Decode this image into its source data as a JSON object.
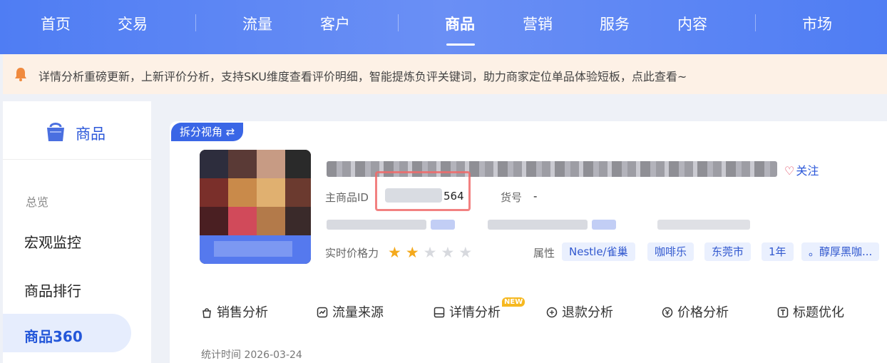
{
  "nav": {
    "items": [
      {
        "label": "首页"
      },
      {
        "label": "交易"
      },
      {
        "label": "流量"
      },
      {
        "label": "客户"
      },
      {
        "label": "商品",
        "active": true
      },
      {
        "label": "营销"
      },
      {
        "label": "服务"
      },
      {
        "label": "内容"
      },
      {
        "label": "市场"
      }
    ]
  },
  "notice": {
    "text": "详情分析重磅更新，上新评价分析，支持SKU维度查看评价明细，智能提炼负评关键词，助力商家定位单品体验短板，点此查看~"
  },
  "sidebar": {
    "title": "商品",
    "group_label": "总览",
    "items": [
      {
        "label": "宏观监控"
      },
      {
        "label": "商品排行"
      },
      {
        "label": "商品360",
        "active": true
      }
    ]
  },
  "product": {
    "split_view_label": "拆分视角 ⇄",
    "follow_label": "关注",
    "main_id_label": "主商品ID",
    "main_id_visible_suffix": "564",
    "item_no_label": "货号",
    "item_no_value": "-",
    "price_power_label": "实时价格力",
    "price_power_stars": 2,
    "price_power_max": 5,
    "attr_label": "属性",
    "attrs": [
      "Nestle/雀巢",
      "咖啡乐",
      "东莞市",
      "1年",
      "。醇厚黑咖..."
    ]
  },
  "tabs": [
    {
      "label": "销售分析",
      "icon": "bag-icon"
    },
    {
      "label": "流量来源",
      "icon": "trend-icon"
    },
    {
      "label": "详情分析",
      "icon": "detail-icon",
      "badge": "NEW"
    },
    {
      "label": "退款分析",
      "icon": "refund-icon"
    },
    {
      "label": "价格分析",
      "icon": "yen-icon"
    },
    {
      "label": "标题优化",
      "icon": "title-icon"
    }
  ],
  "stat_time": "统计时间 2026-03-24",
  "colors": {
    "nav_bg": "#4f7df3",
    "accent": "#2b57d9",
    "notice_bg": "#fdf1e6",
    "star_on": "#f4a91c",
    "highlight_border": "#f06b6b"
  }
}
